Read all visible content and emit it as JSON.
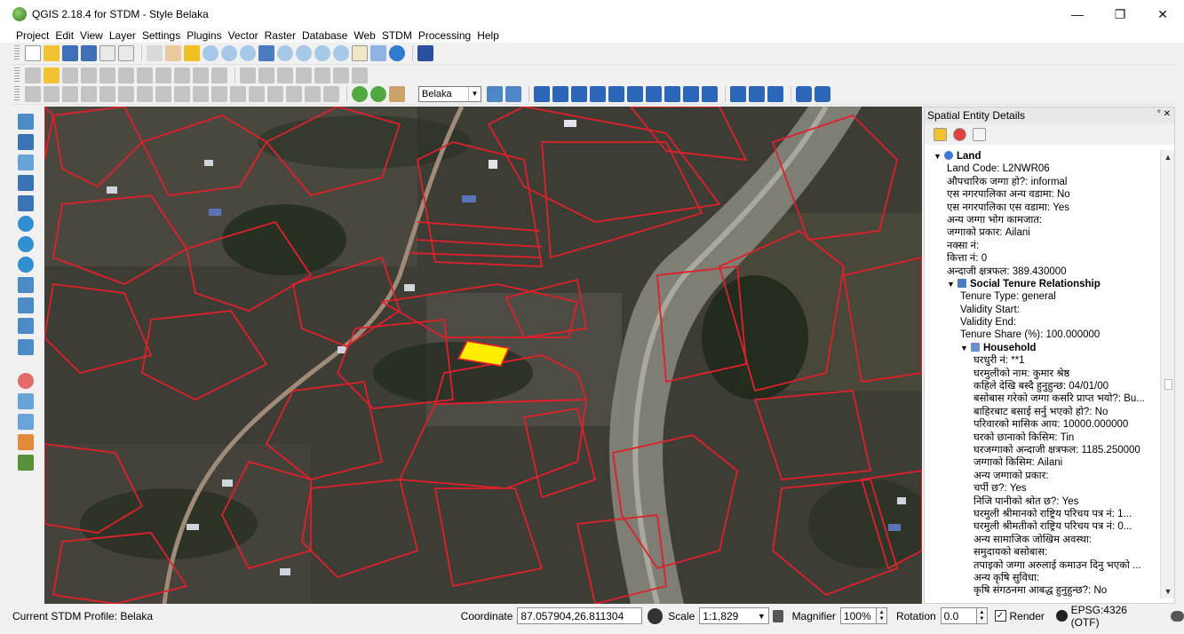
{
  "window": {
    "title": "QGIS 2.18.4 for STDM  - Style Belaka",
    "minimize_glyph": "—",
    "maximize_glyph": "❐",
    "close_glyph": "✕"
  },
  "menu": [
    "Project",
    "Edit",
    "View",
    "Layer",
    "Settings",
    "Plugins",
    "Vector",
    "Raster",
    "Database",
    "Web",
    "STDM",
    "Processing",
    "Help"
  ],
  "toolbar": {
    "profile_combo": "Belaka"
  },
  "panel": {
    "title": "Spatial Entity Details",
    "controls": "° ✕",
    "tree": [
      {
        "level": 0,
        "node": true,
        "icon": "globe-icon",
        "text": "Land"
      },
      {
        "level": 1,
        "text": "Land Code: L2NWR06"
      },
      {
        "level": 1,
        "text": "औपचारिक जग्गा हो?: informal"
      },
      {
        "level": 1,
        "text": "एस नगरपालिका अन्य वडामा: No"
      },
      {
        "level": 1,
        "text": "एस नगरपालिका एस वडामा: Yes"
      },
      {
        "level": 1,
        "text": "अन्य जग्गा भोग कामजात:"
      },
      {
        "level": 1,
        "text": "जग्गाको प्रकार: Ailani"
      },
      {
        "level": 1,
        "text": "नक्सा नं:"
      },
      {
        "level": 1,
        "text": "कित्ता नं: 0"
      },
      {
        "level": 1,
        "text": "अन्दाजी क्षत्रफल: 389.430000"
      },
      {
        "level": 1,
        "node": true,
        "icon": "tenure-icon",
        "text": "Social Tenure Relationship"
      },
      {
        "level": 2,
        "text": "Tenure Type: general"
      },
      {
        "level": 2,
        "text": "Validity Start:"
      },
      {
        "level": 2,
        "text": "Validity End:"
      },
      {
        "level": 2,
        "text": "Tenure Share (%): 100.000000"
      },
      {
        "level": 2,
        "node": true,
        "icon": "table-icon",
        "text": "Household"
      },
      {
        "level": 3,
        "text": "घरधुरी नं: **1"
      },
      {
        "level": 3,
        "text": "घरमुलीको नाम: कुमार श्रेष्ठ"
      },
      {
        "level": 3,
        "text": "कहिले देखि बस्दै हुनुहुन्छ: 04/01/00"
      },
      {
        "level": 3,
        "text": "बसोबास गरेको जग्गा कसरि प्राप्त भयो?: Bu..."
      },
      {
        "level": 3,
        "text": "बाहिरबाट बसाई सर्नु भएको हो?: No"
      },
      {
        "level": 3,
        "text": "परिवारको मासिक आय: 10000.000000"
      },
      {
        "level": 3,
        "text": "घरको छानाको किसिम: Tin"
      },
      {
        "level": 3,
        "text": "घरजग्गाको अन्दाजी क्षत्रफल: 1185.250000"
      },
      {
        "level": 3,
        "text": "जग्गाको किसिम: Ailani"
      },
      {
        "level": 3,
        "text": "अन्य जग्गाको प्रकार:"
      },
      {
        "level": 3,
        "text": "चर्पी छ?: Yes"
      },
      {
        "level": 3,
        "text": "निजि पानीको श्रोत छ?: Yes"
      },
      {
        "level": 3,
        "text": "घरमुली श्रीमानको राष्ट्रिय परिचय पत्र नं: 1..."
      },
      {
        "level": 3,
        "text": "घरमुली श्रीमतीको राष्ट्रिय परिचय पत्र नं: 0..."
      },
      {
        "level": 3,
        "text": "अन्य सामाजिक जोखिम अवस्था:"
      },
      {
        "level": 3,
        "text": "समुदायको बसोबास:"
      },
      {
        "level": 3,
        "text": "तपाइको जग्गा अरुलाई कमाउन दिनु भएको ..."
      },
      {
        "level": 3,
        "text": "अन्य कृषि सुविधा:"
      },
      {
        "level": 3,
        "text": "कृषि संगठनमा आबद्ध हुनुहुन्छ?: No"
      }
    ]
  },
  "status": {
    "profile": "Current STDM Profile: Belaka",
    "coordinate_label": "Coordinate",
    "coordinate": "87.057904,26.811304",
    "scale_label": "Scale",
    "scale": "1:1,829",
    "magnifier_label": "Magnifier",
    "magnifier": "100%",
    "rotation_label": "Rotation",
    "rotation": "0.0",
    "render_label": "Render",
    "render_checked": true,
    "crs": "EPSG:4326 (OTF)"
  },
  "colors": {
    "parcel_outline": "#e0202a",
    "selected_parcel": "#ffee00",
    "accent": "#1e6fd0"
  }
}
